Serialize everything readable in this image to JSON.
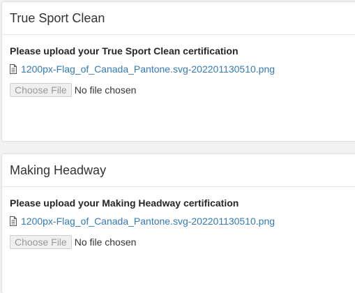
{
  "sections": [
    {
      "title": "True Sport Clean",
      "upload_label": "Please upload your True Sport Clean certification",
      "file_link": "1200px-Flag_of_Canada_Pantone.svg-202201130510.png",
      "choose_button": "Choose File",
      "file_status": "No file chosen"
    },
    {
      "title": "Making Headway",
      "upload_label": "Please upload your Making Headway certification",
      "file_link": "1200px-Flag_of_Canada_Pantone.svg-202201130510.png",
      "choose_button": "Choose File",
      "file_status": "No file chosen"
    }
  ],
  "icons": {
    "file": "document-icon"
  },
  "colors": {
    "link": "#337ab7",
    "page_background": "#f2f2f2",
    "panel_background": "#ffffff"
  }
}
